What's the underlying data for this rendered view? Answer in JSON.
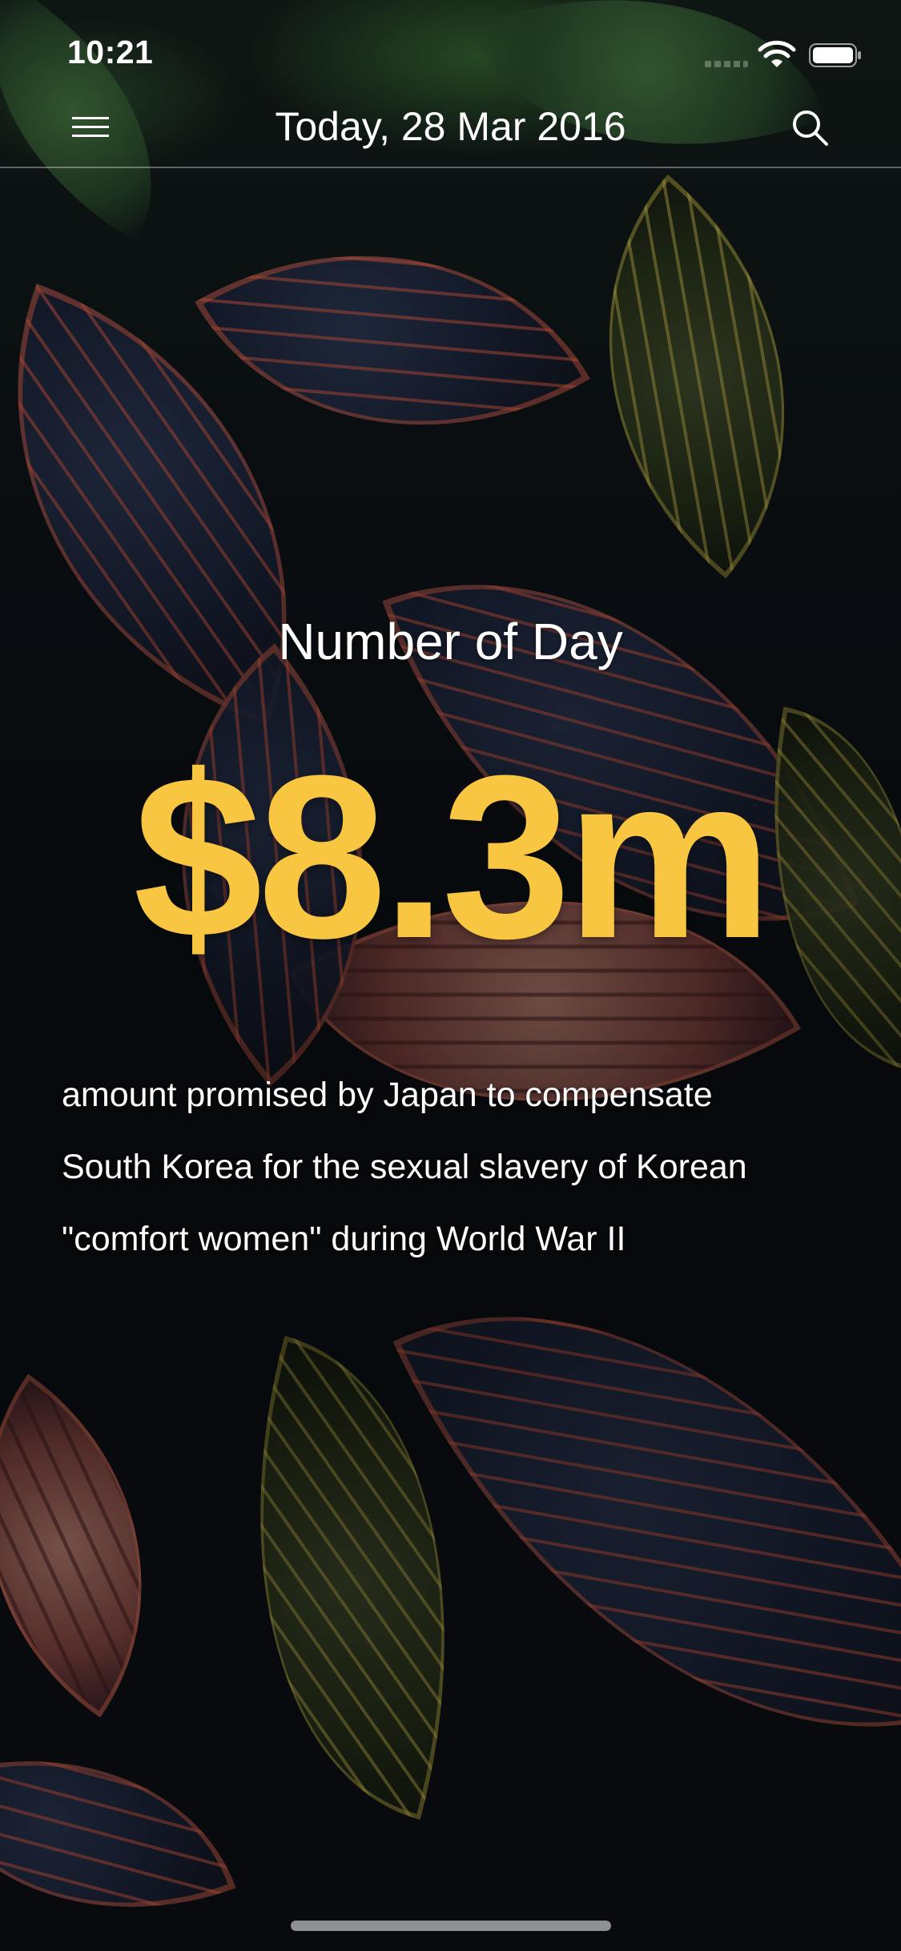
{
  "status_bar": {
    "time": "10:21",
    "icons": [
      "wifi-icon",
      "battery-icon"
    ]
  },
  "nav": {
    "title": "Today, 28 Mar 2016",
    "menu_icon": "hamburger-menu-icon",
    "search_icon": "search-icon"
  },
  "content": {
    "heading": "Number of Day",
    "value": "$8.3m",
    "description_lines": [
      "amount promised by Japan to compensate",
      "South Korea for the sexual slavery of Korean",
      "\"comfort women\" during World War II"
    ]
  },
  "colors": {
    "accent": "#f9c642",
    "text": "#ffffff"
  }
}
